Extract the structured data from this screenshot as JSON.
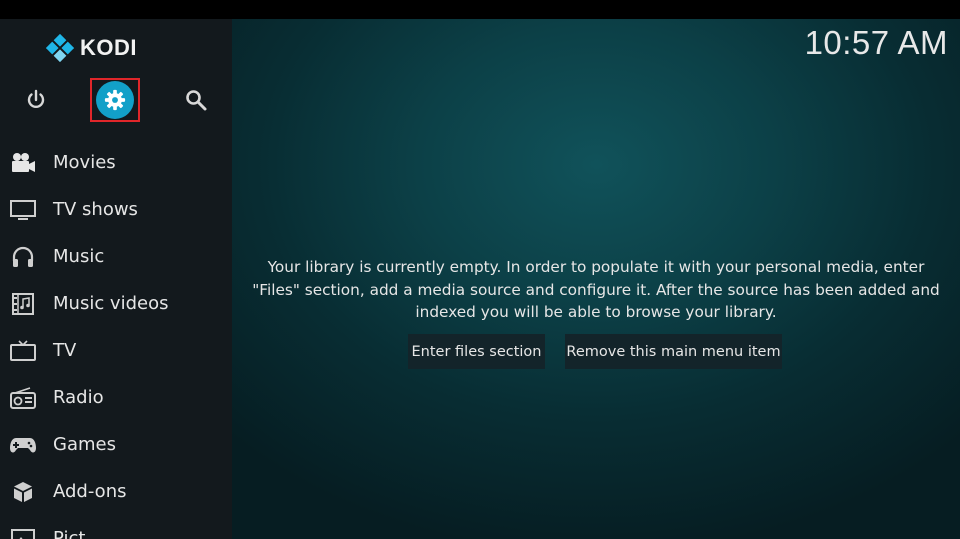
{
  "app": {
    "logo_text": "KODI",
    "clock": "10:57 AM"
  },
  "top_icons": {
    "power": "power-icon",
    "settings": "gear-icon",
    "search": "search-icon",
    "settings_highlight_color": "#e0262a",
    "settings_circle_color": "#12a0c8"
  },
  "menu": {
    "items": [
      {
        "label": "Movies",
        "icon": "movie-camera-icon"
      },
      {
        "label": "TV shows",
        "icon": "monitor-icon"
      },
      {
        "label": "Music",
        "icon": "headphones-icon"
      },
      {
        "label": "Music videos",
        "icon": "film-strip-icon"
      },
      {
        "label": "TV",
        "icon": "tv-icon"
      },
      {
        "label": "Radio",
        "icon": "radio-icon"
      },
      {
        "label": "Games",
        "icon": "gamepad-icon"
      },
      {
        "label": "Add-ons",
        "icon": "box-icon"
      },
      {
        "label": "Pict",
        "icon": "picture-icon"
      }
    ]
  },
  "main": {
    "message": "Your library is currently empty. In order to populate it with your personal media, enter \"Files\" section, add a media source and configure it. After the source has been added and indexed you will be able to browse your library.",
    "buttons": {
      "enter_files": "Enter files section",
      "remove_item": "Remove this main menu item"
    }
  }
}
